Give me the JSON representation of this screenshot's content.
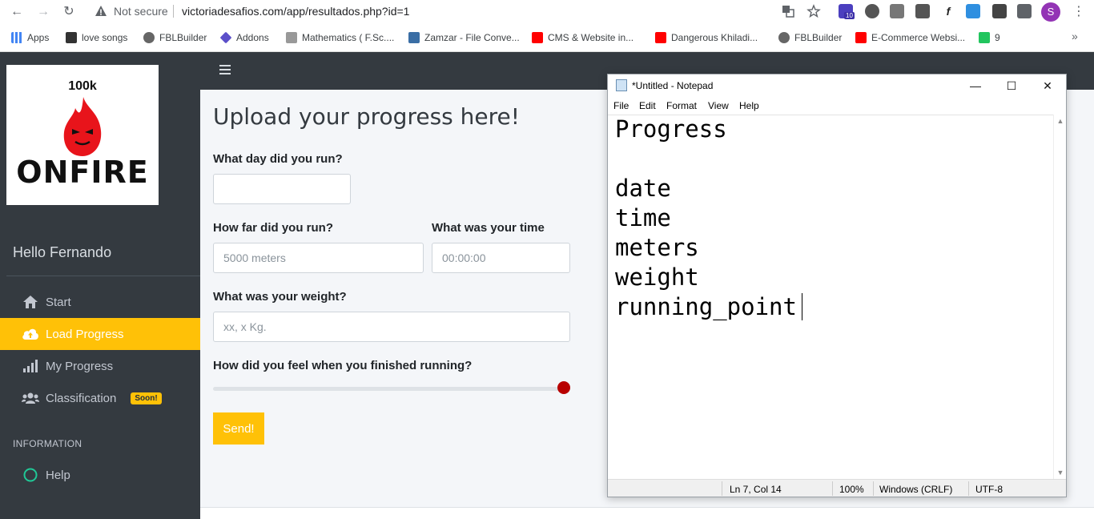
{
  "browser": {
    "nav": {
      "back": "←",
      "forward": "→",
      "reload": "↻"
    },
    "not_secure": "Not secure",
    "url": "victoriadesafios.com/app/resultados.php?id=1",
    "extension_badge": "10",
    "profile_initial": "S",
    "bookmarks": [
      {
        "label": "Apps",
        "icon": "apps-grid-icon",
        "color": "#4285f4"
      },
      {
        "label": "love songs",
        "icon": "bookmark-icon",
        "color": "#333333"
      },
      {
        "label": "FBLBuilder",
        "icon": "globe-icon",
        "color": "#555555"
      },
      {
        "label": "Addons",
        "icon": "addons-icon",
        "color": "#5b4fc9"
      },
      {
        "label": "Mathematics ( F.Sc....",
        "icon": "math-icon",
        "color": "#888888"
      },
      {
        "label": "Zamzar - File Conve...",
        "icon": "zamzar-icon",
        "color": "#3a6ea5"
      },
      {
        "label": "CMS & Website in...",
        "icon": "youtube-icon",
        "color": "#ff0000"
      },
      {
        "label": "Dangerous Khiladi...",
        "icon": "youtube-icon",
        "color": "#ff0000"
      },
      {
        "label": "FBLBuilder",
        "icon": "globe-icon",
        "color": "#555555"
      },
      {
        "label": "E-Commerce Websi...",
        "icon": "youtube-icon",
        "color": "#ff0000"
      },
      {
        "label": "9",
        "icon": "h-icon",
        "color": "#22c55e"
      }
    ],
    "more": "»"
  },
  "app": {
    "logo": {
      "top_text": "100k",
      "brand": "ONFIRE"
    },
    "greeting": "Hello Fernando",
    "nav": [
      {
        "label": "Start",
        "icon": "home-icon",
        "active": false
      },
      {
        "label": "Load Progress",
        "icon": "cloud-upload-icon",
        "active": true
      },
      {
        "label": "My Progress",
        "icon": "signal-bars-icon",
        "active": false
      },
      {
        "label": "Classification",
        "icon": "users-icon",
        "active": false,
        "badge": "Soon!"
      }
    ],
    "section_header": "INFORMATION",
    "help": {
      "label": "Help",
      "icon": "circle-icon"
    },
    "accent": "#ffc107"
  },
  "form": {
    "title": "Upload your progress here!",
    "day_label": "What day did you run?",
    "day_value": "",
    "distance_label": "How far did you run?",
    "distance_placeholder": "5000 meters",
    "time_label": "What was your time",
    "time_placeholder": "00:00:00",
    "weight_label": "What was your weight?",
    "weight_placeholder": "xx, x Kg.",
    "feeling_label": "How did you feel when you finished running?",
    "feeling_level": 1.0,
    "send_label": "Send!"
  },
  "notepad": {
    "title": "*Untitled - Notepad",
    "window_buttons": {
      "minimize": "—",
      "maximize": "☐",
      "close": "✕"
    },
    "menu": [
      "File",
      "Edit",
      "Format",
      "View",
      "Help"
    ],
    "lines": [
      "Progress",
      "",
      "date",
      "time",
      "meters",
      "weight",
      "running_point"
    ],
    "status": {
      "position": "Ln 7, Col 14",
      "zoom": "100%",
      "line_ending": "Windows (CRLF)",
      "encoding": "UTF-8"
    }
  }
}
